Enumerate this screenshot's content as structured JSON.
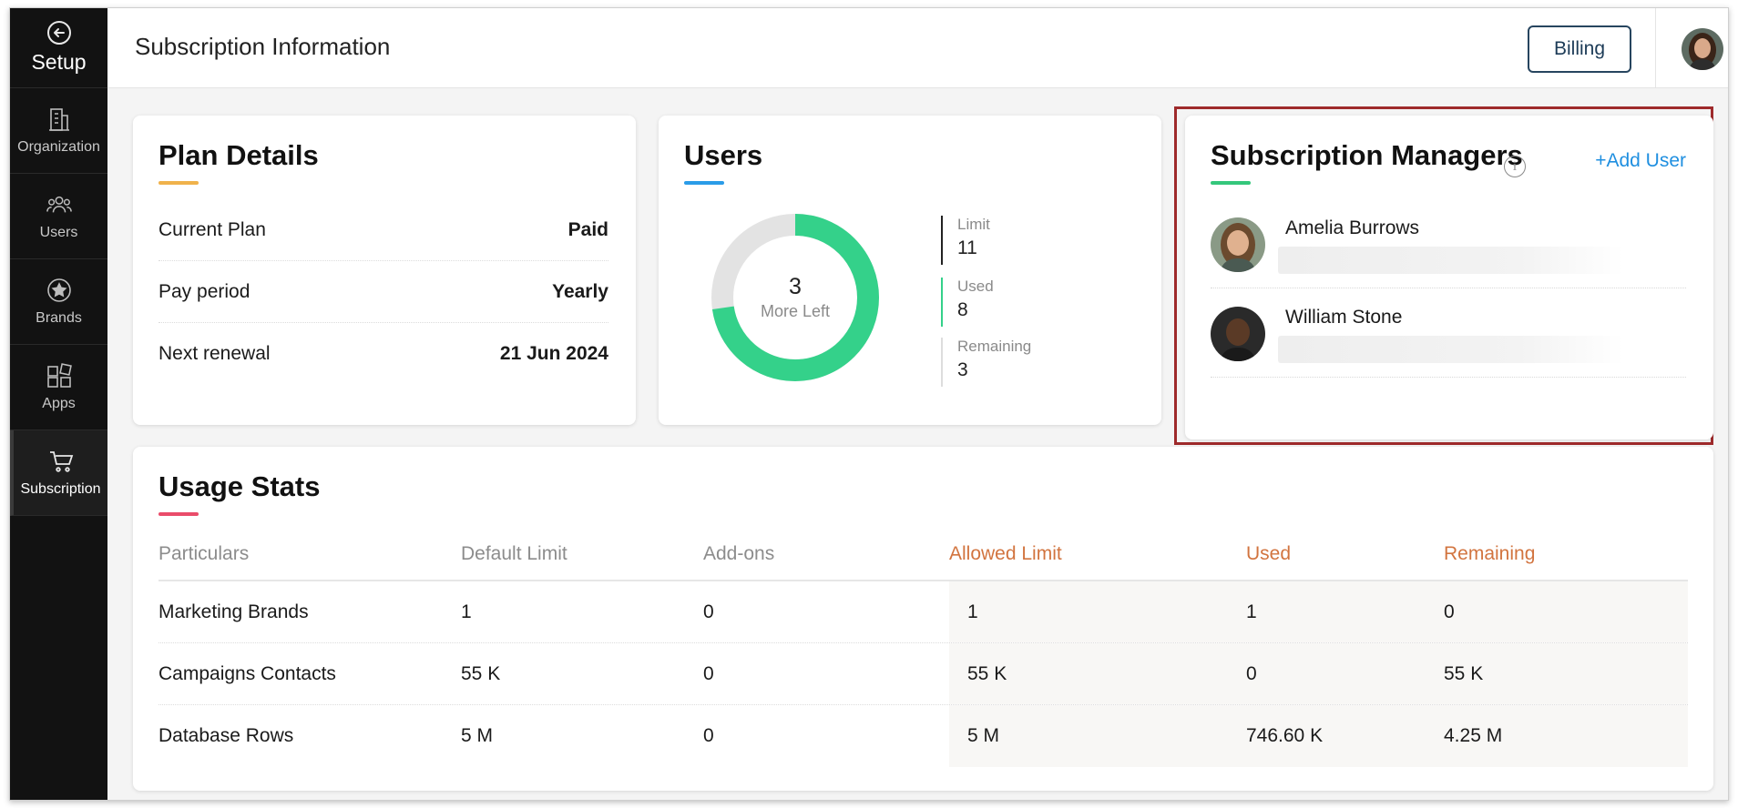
{
  "sidebar": {
    "setup_label": "Setup",
    "items": [
      {
        "label": "Organization",
        "icon": "building-icon"
      },
      {
        "label": "Users",
        "icon": "users-icon"
      },
      {
        "label": "Brands",
        "icon": "star-badge-icon"
      },
      {
        "label": "Apps",
        "icon": "apps-grid-icon"
      },
      {
        "label": "Subscription",
        "icon": "cart-icon",
        "active": true
      }
    ]
  },
  "header": {
    "title": "Subscription Information",
    "billing_label": "Billing"
  },
  "plan": {
    "title": "Plan Details",
    "accent": "#f0b24b",
    "rows": [
      {
        "label": "Current Plan",
        "value": "Paid"
      },
      {
        "label": "Pay period",
        "value": "Yearly"
      },
      {
        "label": "Next renewal",
        "value": "21 Jun 2024"
      }
    ]
  },
  "users": {
    "title": "Users",
    "accent": "#2a9ce8",
    "donut": {
      "used_fraction": 0.727,
      "center_value": "3",
      "center_label": "More Left",
      "used_color": "#34d18a",
      "remaining_color": "#e3e3e3"
    },
    "stats": [
      {
        "label": "Limit",
        "value": "11",
        "color": "#222222"
      },
      {
        "label": "Used",
        "value": "8",
        "color": "#34d18a"
      },
      {
        "label": "Remaining",
        "value": "3",
        "color": "#dddddd"
      }
    ]
  },
  "subscription_managers": {
    "title": "Subscription Managers",
    "accent": "#34c77b",
    "add_user_label": "+Add User",
    "managers": [
      {
        "name": "Amelia Burrows"
      },
      {
        "name": "William Stone"
      }
    ]
  },
  "usage": {
    "title": "Usage Stats",
    "accent": "#ea4c6a",
    "columns": [
      "Particulars",
      "Default Limit",
      "Add-ons",
      "Allowed Limit",
      "Used",
      "Remaining"
    ],
    "rows": [
      [
        "Marketing Brands",
        "1",
        "0",
        "1",
        "1",
        "0"
      ],
      [
        "Campaigns Contacts",
        "55 K",
        "0",
        "55 K",
        "0",
        "55 K"
      ],
      [
        "Database Rows",
        "5 M",
        "0",
        "5 M",
        "746.60 K",
        "4.25 M"
      ]
    ]
  }
}
